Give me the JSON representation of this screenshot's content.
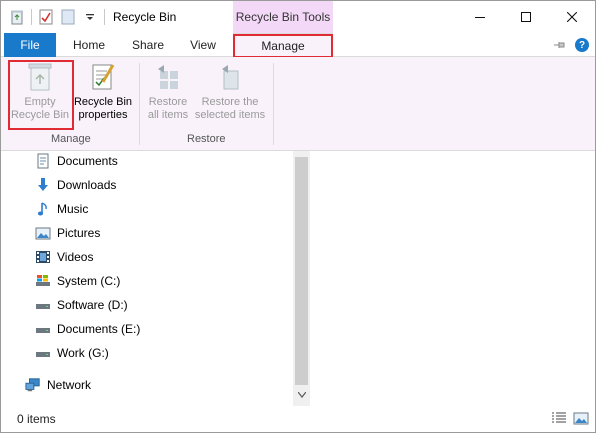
{
  "window": {
    "title": "Recycle Bin"
  },
  "ribbon_tabs": {
    "file": "File",
    "home": "Home",
    "share": "Share",
    "view": "View",
    "context_header": "Recycle Bin Tools",
    "manage": "Manage"
  },
  "ribbon": {
    "empty_line1": "Empty",
    "empty_line2": "Recycle Bin",
    "props_line1": "Recycle Bin",
    "props_line2": "properties",
    "restore_all_line1": "Restore",
    "restore_all_line2": "all items",
    "restore_sel_line1": "Restore the",
    "restore_sel_line2": "selected items",
    "group_manage": "Manage",
    "group_restore": "Restore"
  },
  "nav": {
    "items": [
      {
        "label": "Documents",
        "icon": "documents-icon"
      },
      {
        "label": "Downloads",
        "icon": "downloads-icon"
      },
      {
        "label": "Music",
        "icon": "music-icon"
      },
      {
        "label": "Pictures",
        "icon": "pictures-icon"
      },
      {
        "label": "Videos",
        "icon": "videos-icon"
      },
      {
        "label": "System (C:)",
        "icon": "drive-icon"
      },
      {
        "label": "Software (D:)",
        "icon": "drive-icon"
      },
      {
        "label": "Documents (E:)",
        "icon": "drive-icon"
      },
      {
        "label": "Work (G:)",
        "icon": "drive-icon"
      }
    ],
    "network": "Network"
  },
  "status": {
    "items_count": "0 items"
  },
  "colors": {
    "file_tab": "#1979ca",
    "context_header_bg": "#f3d9f7",
    "ribbon_bg": "#f9f2fb",
    "highlight": "#e02b35"
  }
}
